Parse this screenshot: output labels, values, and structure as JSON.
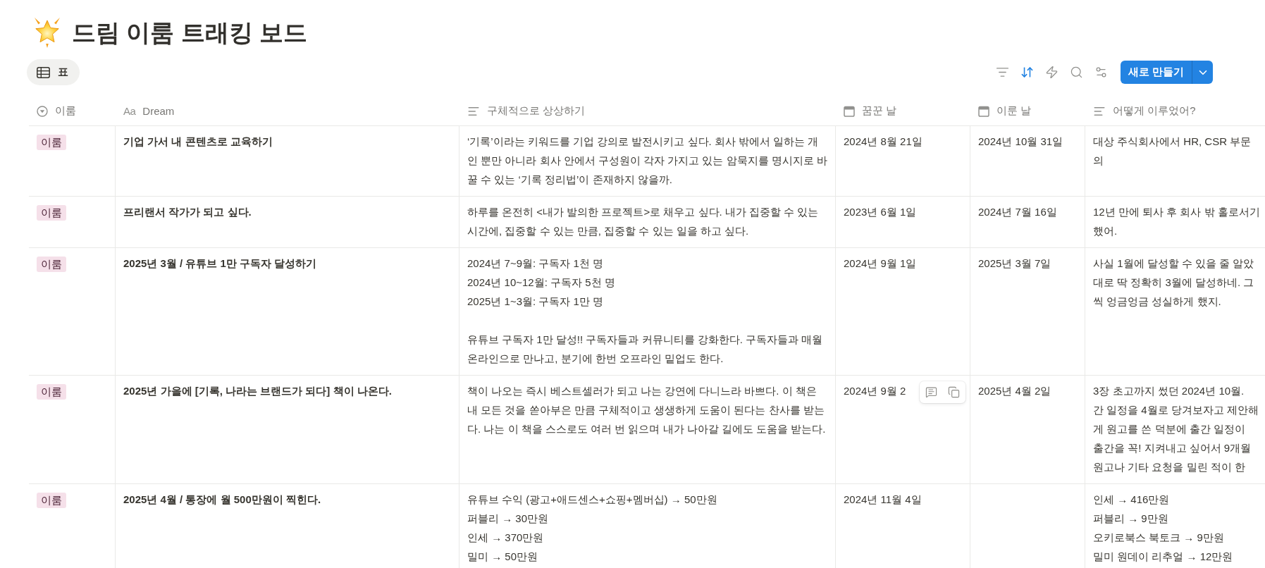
{
  "page": {
    "title": "드림 이룸 트래킹 보드"
  },
  "views": [
    {
      "label": "표",
      "selected": true
    }
  ],
  "toolbar": {
    "tools": [
      {
        "kind": "filter",
        "active": false
      },
      {
        "kind": "sort",
        "active": true
      },
      {
        "kind": "automation",
        "active": false
      },
      {
        "kind": "search",
        "active": false
      },
      {
        "kind": "settings",
        "active": false
      }
    ],
    "new_button": {
      "label": "새로 만들기"
    }
  },
  "table": {
    "columns": [
      {
        "kind": "select",
        "label": "이룸"
      },
      {
        "kind": "title",
        "glyph": "Aa",
        "label": "Dream"
      },
      {
        "kind": "text",
        "label": "구체적으로 상상하기"
      },
      {
        "kind": "date",
        "label": "꿈꾼 날"
      },
      {
        "kind": "date",
        "label": "이룬 날"
      },
      {
        "kind": "text",
        "label": "어떻게 이루었어?"
      }
    ],
    "rows": [
      {
        "hovered": false,
        "tag": "이룸",
        "dream": "기업 가서 내 콘텐츠로 교육하기",
        "imagine": "‘기록’이라는 키워드를 기업 강의로 발전시키고 싶다. 회사 밖에서 일하는 개인 뿐만 아니라 회사 안에서 구성원이 각자 가지고 있는 암묵지를 명시지로 바꿀 수 있는 ‘기록 정리법’이 존재하지 않을까.",
        "dreamed": "2024년 8월 21일",
        "achieved": "2024년 10월 31일",
        "how": "대상 주식회사에서 HR, CSR 부문\n의"
      },
      {
        "hovered": false,
        "tag": "이룸",
        "dream": "프리랜서 작가가 되고 싶다.",
        "imagine": "하루를 온전히 <내가 발의한 프로젝트>로 채우고 싶다. 내가 집중할 수 있는 시간에, 집중할 수 있는 만큼, 집중할 수 있는 일을 하고 싶다.",
        "dreamed": "2023년 6월 1일",
        "achieved": "2024년 7월 16일",
        "how": "12년 만에 퇴사 후 회사 밖 홀로서기\n했어."
      },
      {
        "hovered": false,
        "tag": "이룸",
        "dream": "2025년 3월 / 유튜브 1만 구독자 달성하기",
        "imagine": "2024년 7~9월: 구독자 1천 명\n2024년 10~12월: 구독자 5천 명\n2025년 1~3월: 구독자 1만 명\n\n유튜브 구독자 1만 달성!! 구독자들과 커뮤니티를 강화한다. 구독자들과 매월 온라인으로 만나고, 분기에 한번 오프라인 밑업도 한다.",
        "dreamed": "2024년 9월 1일",
        "achieved": "2025년 3월 7일",
        "how": "사실 1월에 달성할 수 있을 줄 알았\n대로 딱 정확히 3월에 달성하네. 그\n씩 엉금엉금 성실하게 했지."
      },
      {
        "hovered": true,
        "tag": "이룸",
        "dream": "2025년 가을에 [기록, 나라는 브랜드가 되다] 책이 나온다.",
        "imagine": "책이 나오는 즉시 베스트셀러가 되고 나는 강연에 다니느라 바쁘다. 이 책은 내 모든 것을 쏟아부은 만큼 구체적이고 생생하게 도움이 된다는 찬사를 받는다. 나는 이 책을 스스로도 여러 번 읽으며 내가 나아갈 길에도 도움을 받는다.",
        "dreamed": "2024년 9월 2",
        "achieved": "2025년 4월 2일",
        "how": "3장 초고까지 썼던 2024년 10월.\n간 일정을 4월로 당겨보자고 제안해\n게 원고를 쓴 덕분에 출간 일정이\n출간을 꼭! 지켜내고 싶어서 9개월\n원고나 기타 요청을 밀린 적이 한"
      },
      {
        "hovered": false,
        "tag": "이룸",
        "dream": "2025년 4월 / 통장에 월 500만원이 찍힌다.",
        "imagine": "유튜브 수익 (광고+애드센스+쇼핑+멤버십) → 50만원\n퍼블리 → 30만원\n인세 → 370만원\n밀미 → 50만원",
        "dreamed": "2024년 11월 4일",
        "how": "인세 → 416만원\n퍼블리 → 9만원\n오키로북스 북토크 → 9만원\n밀미 원데이 리추얼 → 12만원"
      }
    ]
  }
}
